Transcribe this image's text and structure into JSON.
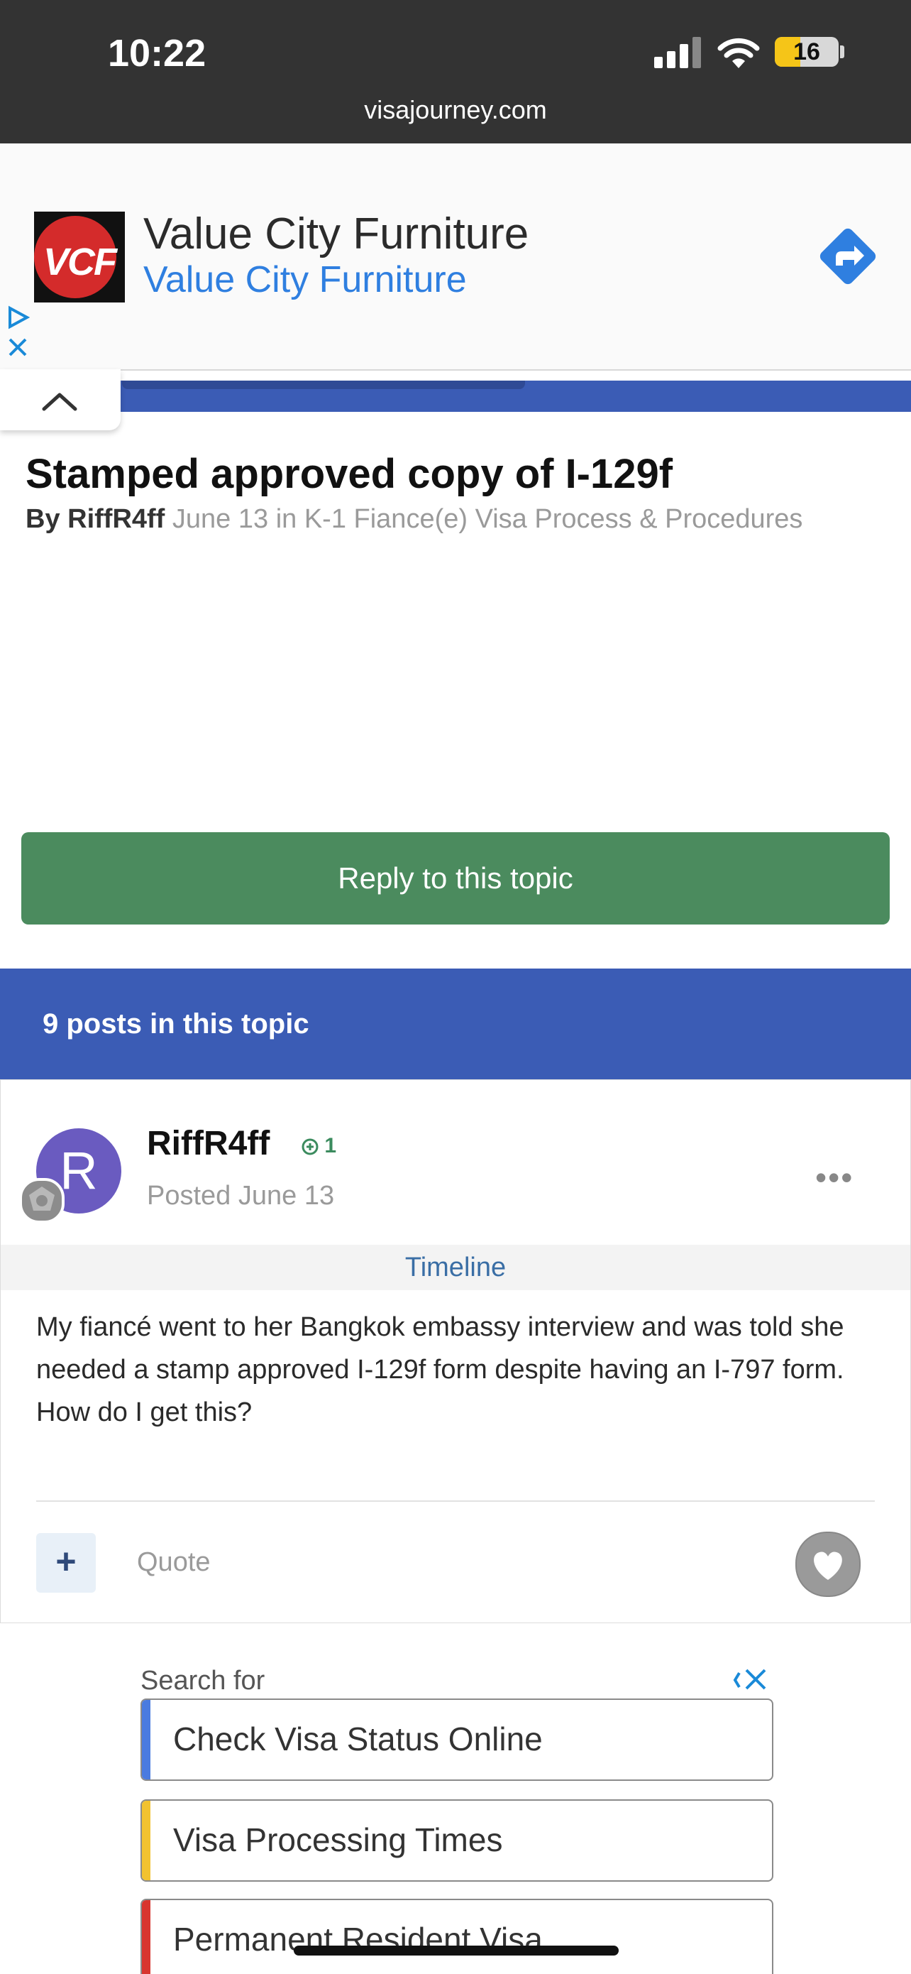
{
  "status_bar": {
    "time": "10:22",
    "battery": "16",
    "url": "visajourney.com"
  },
  "ad_top": {
    "logo_text": "VCF",
    "title": "Value City Furniture",
    "subtitle": "Value City Furniture"
  },
  "topic": {
    "title": "Stamped approved copy of I-129f",
    "by_prefix": "By",
    "author": "RiffR4ff",
    "meta": "June 13 in K-1 Fiance(e) Visa Process & Procedures"
  },
  "reply_button": "Reply to this topic",
  "posts_count": "9 posts in this topic",
  "post": {
    "avatar_letter": "R",
    "author": "RiffR4ff",
    "reputation": "1",
    "posted": "Posted June 13",
    "menu": "•••",
    "timeline": "Timeline",
    "body": "My fiancé went to her Bangkok embassy interview and was told she needed a stamp approved I-129f form despite having an I-797 form. How do I get this?",
    "multiquote": "+",
    "quote": "Quote"
  },
  "search_ad": {
    "label": "Search for",
    "items": [
      {
        "text": "Check Visa Status Online",
        "color": "#4a7be0"
      },
      {
        "text": "Visa Processing Times",
        "color": "#f2c230"
      },
      {
        "text": "Permanent Resident Visa",
        "color": "#d8352f"
      }
    ]
  },
  "colors": {
    "nav_blue": "#3b5cb5",
    "reply_green": "#4b8b5e",
    "ad_link_blue": "#2f7fe0"
  }
}
